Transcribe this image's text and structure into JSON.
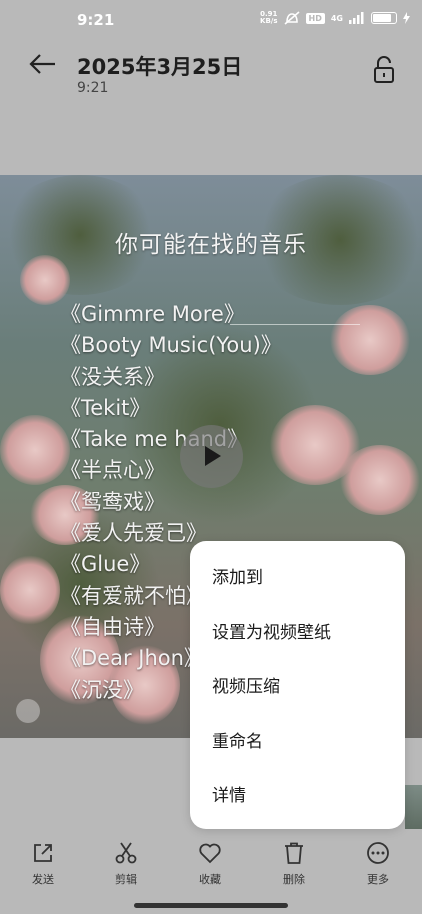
{
  "status_bar": {
    "time": "9:21",
    "net_speed_value": "0.91",
    "net_speed_unit": "KB/s",
    "hd_badge": "HD",
    "network": "4G",
    "battery_level": 0.85
  },
  "header": {
    "date": "2025年3月25日",
    "time": "9:21"
  },
  "video": {
    "overlay_title": "你可能在找的音乐",
    "songs": [
      "《Gimmre More》",
      "《Booty Music(You)》",
      "《没关系》",
      "《Tekit》",
      "《Take me hand》",
      "《半点心》",
      "《鸳鸯戏》",
      "《爱人先爱己》",
      "《Glue》",
      "《有爱就不怕》",
      "《自由诗》",
      "《Dear Jhon》",
      "《沉没》"
    ]
  },
  "context_menu": {
    "items": [
      "添加到",
      "设置为视频壁纸",
      "视频压缩",
      "重命名",
      "详情"
    ]
  },
  "toolbar": {
    "send": "发送",
    "edit": "剪辑",
    "favorite": "收藏",
    "delete": "删除",
    "more": "更多"
  },
  "colors": {
    "background": "#b9b9b9",
    "menu_bg": "#ffffff",
    "text": "#1e1e1e"
  },
  "icons": [
    "back-arrow-icon",
    "unlock-icon",
    "play-icon",
    "share-icon",
    "scissors-icon",
    "heart-icon",
    "trash-icon",
    "more-icon"
  ]
}
